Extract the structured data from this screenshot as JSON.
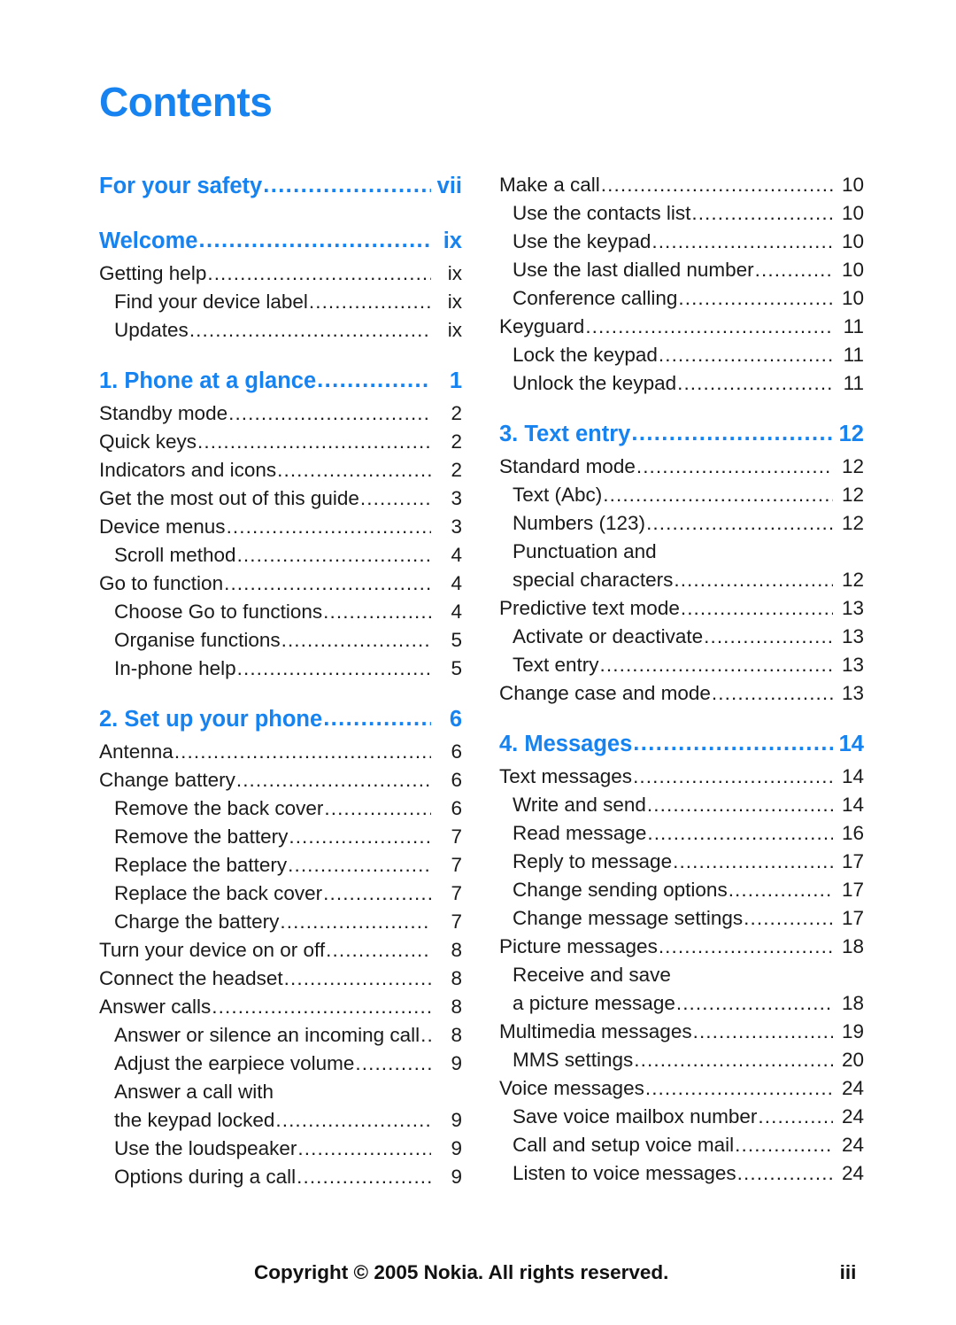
{
  "document": {
    "title": "Contents",
    "accent_color": "#1683f0",
    "text_color": "#1a1a1a",
    "background_color": "#ffffff"
  },
  "toc": {
    "left_column": [
      {
        "level": 0,
        "label": "For your safety",
        "page": "vii",
        "leader": "............................"
      },
      {
        "level": 0,
        "label": "Welcome",
        "page": "ix",
        "leader": ".................................",
        "gap": true
      },
      {
        "level": 1,
        "label": "Getting help",
        "page": "ix",
        "leader": ".........................................."
      },
      {
        "level": 2,
        "label": "Find your device label",
        "page": "ix",
        "leader": "..........................."
      },
      {
        "level": 2,
        "label": "Updates",
        "page": "ix",
        "leader": "..............................................."
      },
      {
        "level": 0,
        "label": "1. Phone at a glance",
        "page": "1",
        "leader": "...................",
        "gap": true
      },
      {
        "level": 1,
        "label": "Standby mode",
        "page": "2",
        "leader": "........................................."
      },
      {
        "level": 1,
        "label": "Quick keys",
        "page": "2",
        "leader": "............................................."
      },
      {
        "level": 1,
        "label": "Indicators and icons",
        "page": "2",
        "leader": "................................."
      },
      {
        "level": 1,
        "label": "Get the most out of this guide",
        "page": "3",
        "leader": "..............."
      },
      {
        "level": 1,
        "label": "Device menus",
        "page": "3",
        "leader": "..........................................."
      },
      {
        "level": 2,
        "label": "Scroll method",
        "page": "4",
        "leader": "......................................"
      },
      {
        "level": 1,
        "label": "Go to function",
        "page": "4",
        "leader": "..........................................."
      },
      {
        "level": 2,
        "label": "Choose Go to functions",
        "page": "4",
        "leader": "........................"
      },
      {
        "level": 2,
        "label": "Organise functions",
        "page": "5",
        "leader": "................................."
      },
      {
        "level": 2,
        "label": "In-phone help",
        "page": "5",
        "leader": "......................................."
      },
      {
        "level": 0,
        "label": "2. Set up your phone",
        "page": "6",
        "leader": "..................",
        "gap": true
      },
      {
        "level": 1,
        "label": "Antenna",
        "page": "6",
        "leader": "................................................."
      },
      {
        "level": 1,
        "label": "Change battery",
        "page": "6",
        "leader": "........................................"
      },
      {
        "level": 2,
        "label": "Remove the back cover",
        "page": "6",
        "leader": "........................."
      },
      {
        "level": 2,
        "label": "Remove the battery",
        "page": "7",
        "leader": "................................"
      },
      {
        "level": 2,
        "label": "Replace the battery",
        "page": "7",
        "leader": "................................"
      },
      {
        "level": 2,
        "label": "Replace the back cover",
        "page": "7",
        "leader": "..........................."
      },
      {
        "level": 2,
        "label": "Charge the battery",
        "page": "7",
        "leader": "................................."
      },
      {
        "level": 1,
        "label": "Turn your device on or off",
        "page": "8",
        "leader": "........................"
      },
      {
        "level": 1,
        "label": "Connect the headset",
        "page": "8",
        "leader": "................................."
      },
      {
        "level": 1,
        "label": "Answer calls",
        "page": "8",
        "leader": "............................................"
      },
      {
        "level": 2,
        "label": "Answer or silence an incoming call",
        "page": "8",
        "leader": "...."
      },
      {
        "level": 2,
        "label": "Adjust the earpiece volume",
        "page": "9",
        "leader": "................."
      },
      {
        "level": 2,
        "label": "Answer a call with",
        "page": "",
        "leader": "",
        "continuation": true
      },
      {
        "level": 2,
        "label": "the keypad locked",
        "page": "9",
        "leader": "..................................."
      },
      {
        "level": 2,
        "label": "Use the loudspeaker",
        "page": "9",
        "leader": "................................"
      },
      {
        "level": 2,
        "label": "Options during a call",
        "page": "9",
        "leader": "............................."
      }
    ],
    "right_column": [
      {
        "level": 1,
        "label": "Make a call",
        "page": "10",
        "leader": "..........................................."
      },
      {
        "level": 2,
        "label": "Use the contacts list",
        "page": "10",
        "leader": "........................."
      },
      {
        "level": 2,
        "label": "Use the keypad",
        "page": "10",
        "leader": "....................................."
      },
      {
        "level": 2,
        "label": "Use the last dialled number",
        "page": "10",
        "leader": ".............."
      },
      {
        "level": 2,
        "label": "Conference calling",
        "page": "10",
        "leader": ".............................."
      },
      {
        "level": 1,
        "label": "Keyguard",
        "page": "11",
        "leader": "..............................................."
      },
      {
        "level": 2,
        "label": "Lock the keypad",
        "page": "11",
        "leader": "...................................."
      },
      {
        "level": 2,
        "label": "Unlock the keypad",
        "page": "11",
        "leader": "................................"
      },
      {
        "level": 0,
        "label": "3. Text entry",
        "page": "12",
        "leader": ".............................",
        "gap": true
      },
      {
        "level": 1,
        "label": "Standard mode",
        "page": "12",
        "leader": "......................................."
      },
      {
        "level": 2,
        "label": "Text (Abc)",
        "page": "12",
        "leader": "............................................."
      },
      {
        "level": 2,
        "label": "Numbers (123)",
        "page": "12",
        "leader": "....................................."
      },
      {
        "level": 2,
        "label": "Punctuation and",
        "page": "",
        "leader": "",
        "continuation": true
      },
      {
        "level": 2,
        "label": "special characters",
        "page": "12",
        "leader": "................................"
      },
      {
        "level": 1,
        "label": "Predictive text mode",
        "page": "13",
        "leader": ".............................."
      },
      {
        "level": 2,
        "label": "Activate or deactivate",
        "page": "13",
        "leader": "......................."
      },
      {
        "level": 2,
        "label": "Text entry",
        "page": "13",
        "leader": "............................................"
      },
      {
        "level": 1,
        "label": "Change case and mode",
        "page": "13",
        "leader": "........................."
      },
      {
        "level": 0,
        "label": "4. Messages",
        "page": "14",
        "leader": "..............................",
        "gap": true
      },
      {
        "level": 1,
        "label": "Text messages",
        "page": "14",
        "leader": "........................................"
      },
      {
        "level": 2,
        "label": "Write and send",
        "page": "14",
        "leader": "...................................."
      },
      {
        "level": 2,
        "label": "Read message",
        "page": "16",
        "leader": "......................................"
      },
      {
        "level": 2,
        "label": "Reply to message",
        "page": "17",
        "leader": "................................."
      },
      {
        "level": 2,
        "label": "Change sending options",
        "page": "17",
        "leader": "...................."
      },
      {
        "level": 2,
        "label": "Change message settings",
        "page": "17",
        "leader": ".................."
      },
      {
        "level": 1,
        "label": "Picture messages",
        "page": "18",
        "leader": "......................................"
      },
      {
        "level": 2,
        "label": "Receive and save",
        "page": "",
        "leader": "",
        "continuation": true
      },
      {
        "level": 2,
        "label": "a picture message",
        "page": "18",
        "leader": "................................."
      },
      {
        "level": 1,
        "label": "Multimedia messages",
        "page": "19",
        "leader": "............................."
      },
      {
        "level": 2,
        "label": "MMS settings",
        "page": "20",
        "leader": "........................................"
      },
      {
        "level": 1,
        "label": "Voice messages",
        "page": "24",
        "leader": "......................................."
      },
      {
        "level": 2,
        "label": "Save voice mailbox number",
        "page": "24",
        "leader": ".............."
      },
      {
        "level": 2,
        "label": "Call and setup voice mail",
        "page": "24",
        "leader": ".................."
      },
      {
        "level": 2,
        "label": "Listen to voice messages",
        "page": "24",
        "leader": ".................."
      }
    ]
  },
  "footer": {
    "copyright": "Copyright © 2005 Nokia. All rights reserved.",
    "folio": "iii"
  }
}
